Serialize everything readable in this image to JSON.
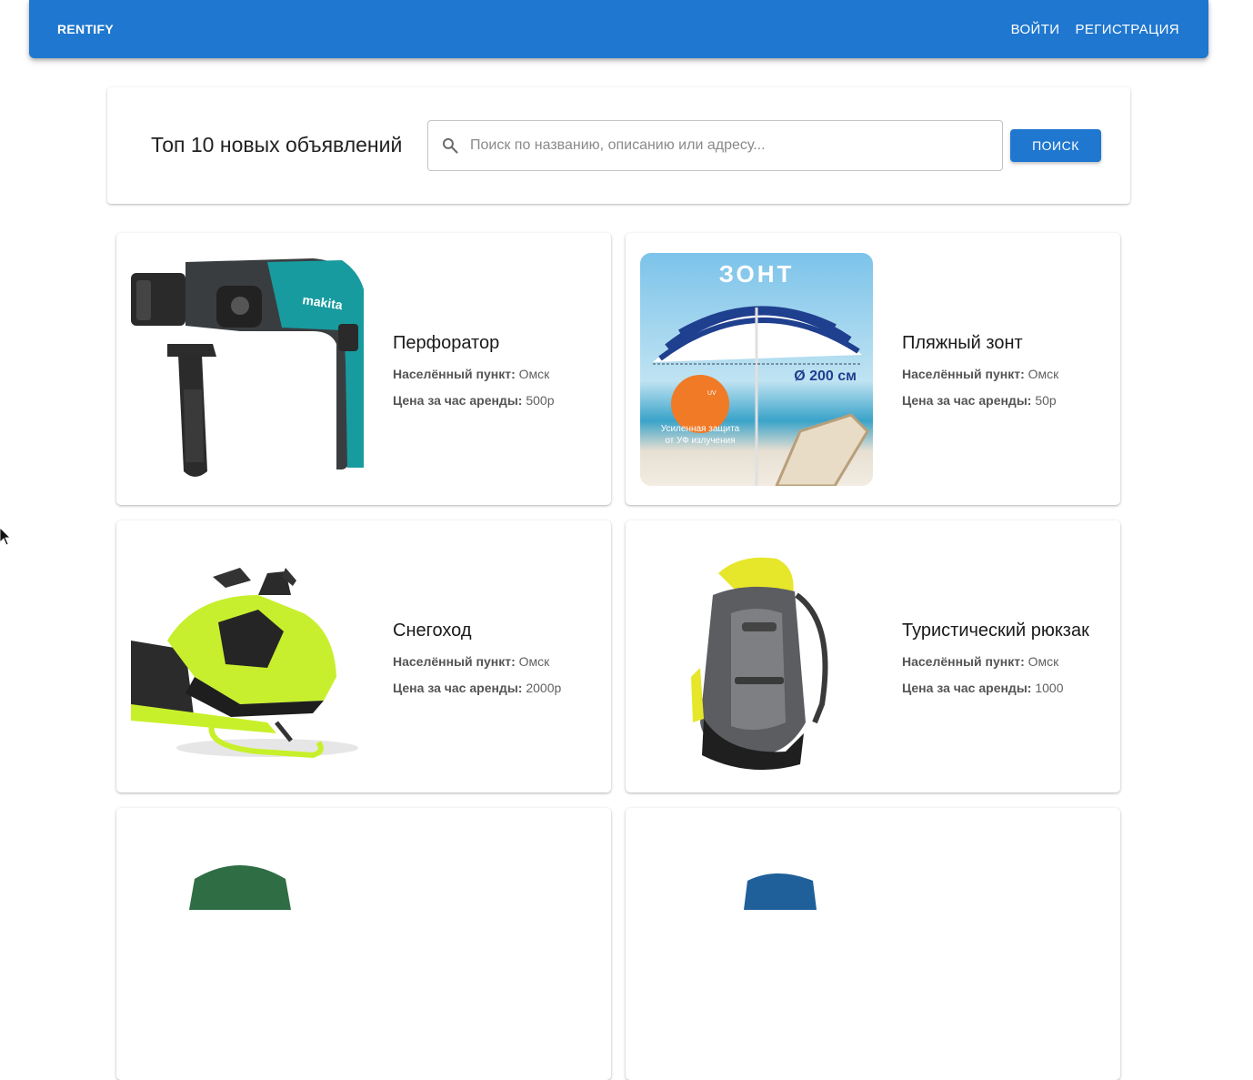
{
  "appbar": {
    "brand": "RENTIFY",
    "login": "ВОЙТИ",
    "register": "РЕГИСТРАЦИЯ",
    "color": "#1f77cf"
  },
  "search": {
    "heading": "Топ 10 новых объявлений",
    "placeholder": "Поиск по названию, описанию или адресу...",
    "value": "",
    "button": "ПОИСК",
    "icon": "search-icon"
  },
  "labels": {
    "city": "Населённый пункт:",
    "price": "Цена за час аренды:"
  },
  "listings": [
    {
      "title": "Перфоратор",
      "city": "Омск",
      "price": "500р",
      "image": "rotary-hammer"
    },
    {
      "title": "Пляжный зонт",
      "city": "Омск",
      "price": "50р",
      "image": "beach-umbrella",
      "image_text": {
        "headline": "ЗОНТ",
        "diameter": "Ø 200 см",
        "badge": "UV",
        "caption1": "Усиленная защита",
        "caption2": "от УФ излучения"
      }
    },
    {
      "title": "Снегоход",
      "city": "Омск",
      "price": "2000р",
      "image": "snowmobile"
    },
    {
      "title": "Туристический рюкзак",
      "city": "Омск",
      "price": "1000",
      "image": "hiking-backpack"
    },
    {
      "title": "",
      "city": "",
      "price": "",
      "image": "green-item"
    },
    {
      "title": "",
      "city": "",
      "price": "",
      "image": "blue-item"
    }
  ]
}
